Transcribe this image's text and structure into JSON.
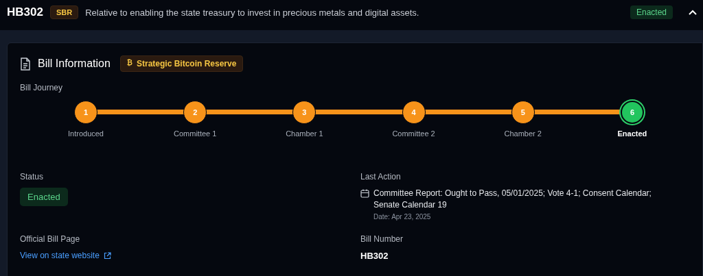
{
  "header": {
    "bill_id": "HB302",
    "tag": "SBR",
    "description": "Relative to enabling the state treasury to invest in precious metals and digital assets.",
    "status": "Enacted",
    "expanded": true
  },
  "card": {
    "title": "Bill Information",
    "topic_icon": "₿",
    "topic": "Strategic Bitcoin Reserve"
  },
  "journey": {
    "label": "Bill Journey",
    "steps": [
      {
        "number": "1",
        "label": "Introduced",
        "current": false
      },
      {
        "number": "2",
        "label": "Committee 1",
        "current": false
      },
      {
        "number": "3",
        "label": "Chamber 1",
        "current": false
      },
      {
        "number": "4",
        "label": "Committee 2",
        "current": false
      },
      {
        "number": "5",
        "label": "Chamber 2",
        "current": false
      },
      {
        "number": "6",
        "label": "Enacted",
        "current": true
      }
    ]
  },
  "status": {
    "label": "Status",
    "value": "Enacted"
  },
  "last_action": {
    "label": "Last Action",
    "text": "Committee Report: Ought to Pass, 05/01/2025; Vote 4-1; Consent Calendar; Senate Calendar 19",
    "date": "Date: Apr 23, 2025"
  },
  "official_page": {
    "label": "Official Bill Page",
    "link": "View on state website"
  },
  "bill_number": {
    "label": "Bill Number",
    "value": "HB302"
  }
}
